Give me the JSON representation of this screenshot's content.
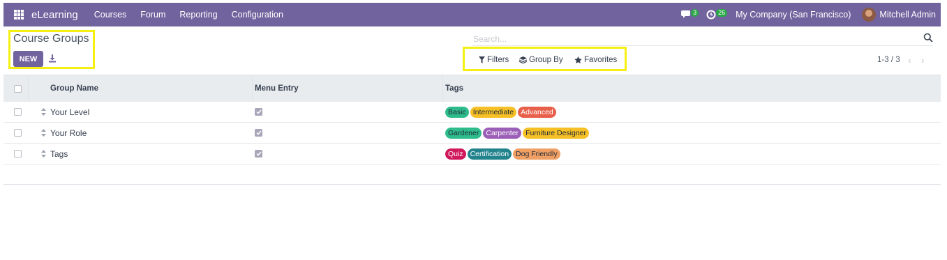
{
  "navbar": {
    "brand": "eLearning",
    "menu": [
      "Courses",
      "Forum",
      "Reporting",
      "Configuration"
    ],
    "messages_count": "3",
    "activities_count": "26",
    "company": "My Company (San Francisco)",
    "user": "Mitchell Admin"
  },
  "control_panel": {
    "title": "Course Groups",
    "new_label": "NEW",
    "search_placeholder": "Search...",
    "filters_label": "Filters",
    "group_by_label": "Group By",
    "favorites_label": "Favorites",
    "pager": "1-3 / 3"
  },
  "table": {
    "headers": [
      "Group Name",
      "Menu Entry",
      "Tags"
    ],
    "rows": [
      {
        "name": "Your Level",
        "menu_entry": true,
        "tags": [
          {
            "label": "Basic",
            "bg": "#2ebc8c",
            "fg": "#1f2937"
          },
          {
            "label": "Intermediate",
            "bg": "#f6c026",
            "fg": "#1f2937"
          },
          {
            "label": "Advanced",
            "bg": "#e8604b",
            "fg": "#ffffff"
          }
        ]
      },
      {
        "name": "Your Role",
        "menu_entry": true,
        "tags": [
          {
            "label": "Gardener",
            "bg": "#2ebc8c",
            "fg": "#1f2937"
          },
          {
            "label": "Carpenter",
            "bg": "#9b5fb7",
            "fg": "#ffffff"
          },
          {
            "label": "Furniture Designer",
            "bg": "#f6c026",
            "fg": "#1f2937"
          }
        ]
      },
      {
        "name": "Tags",
        "menu_entry": true,
        "tags": [
          {
            "label": "Quiz",
            "bg": "#d0195b",
            "fg": "#ffffff"
          },
          {
            "label": "Certification",
            "bg": "#23838d",
            "fg": "#ffffff"
          },
          {
            "label": "Dog Friendly",
            "bg": "#f0a064",
            "fg": "#1f2937"
          }
        ]
      }
    ]
  },
  "colors": {
    "brand": "#71639e",
    "highlight": "#f5f011",
    "badge": "#28a745"
  },
  "icons": [
    "apps-grid-icon",
    "chat-icon",
    "clock-icon",
    "download-icon",
    "search-icon",
    "filter-icon",
    "layers-icon",
    "star-icon",
    "chevron-left-icon",
    "chevron-right-icon",
    "drag-handle-icon"
  ]
}
